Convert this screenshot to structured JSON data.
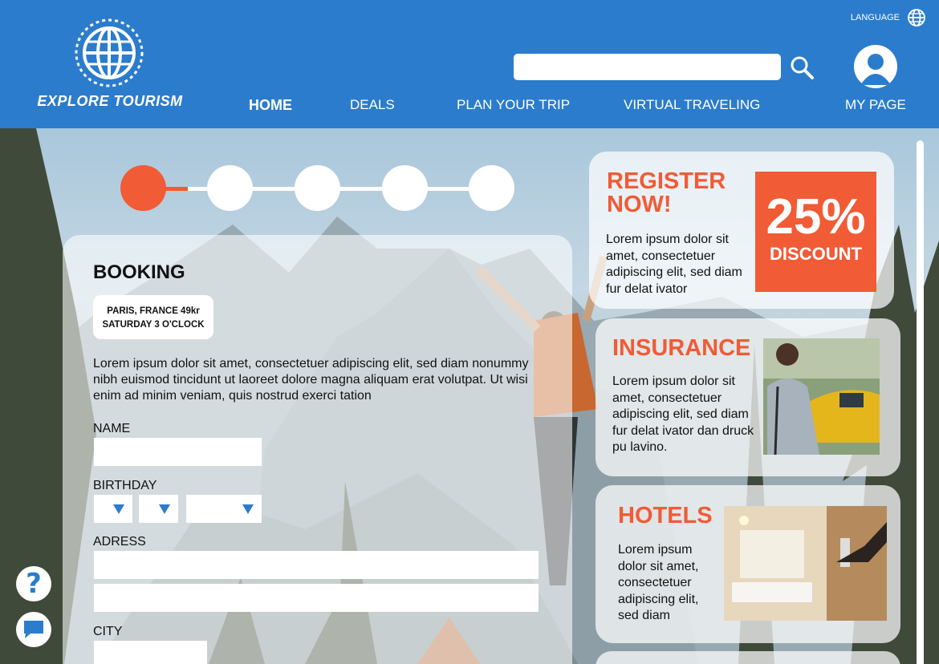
{
  "header": {
    "brand": "EXPLORE TOURISM",
    "language_label": "LANGUAGE",
    "search_placeholder": "",
    "nav": [
      {
        "label": "HOME",
        "active": true
      },
      {
        "label": "DEALS",
        "active": false
      },
      {
        "label": "PLAN YOUR TRIP",
        "active": false
      },
      {
        "label": "VIRTUAL TRAVELING",
        "active": false
      },
      {
        "label": "MY PAGE",
        "active": false
      }
    ]
  },
  "stepper": {
    "total_steps": 5,
    "completed_steps": 1
  },
  "booking": {
    "title": "BOOKING",
    "destination_line1": "PARIS, FRANCE 49kr",
    "destination_line2": "SATURDAY 3 O'CLOCK",
    "description": "Lorem ipsum dolor sit amet, consectetuer adipiscing elit, sed diam nonummy nibh euismod tincidunt ut laoreet dolore magna aliquam erat volutpat. Ut wisi enim ad minim veniam, quis nostrud exerci tation",
    "name_label": "NAME",
    "birthday_label": "BIRTHDAY",
    "address_label": "ADRESS",
    "city_label": "CITY"
  },
  "promos": {
    "register": {
      "title_line1": "REGISTER",
      "title_line2": "NOW!",
      "text": "Lorem ipsum dolor sit amet, consectetuer adipiscing elit, sed diam fur delat ivator",
      "discount_value": "25%",
      "discount_label": "DISCOUNT"
    },
    "insurance": {
      "title": "INSURANCE",
      "text": "Lorem ipsum dolor sit amet, consectetuer adipiscing elit, sed diam fur delat ivator dan druck pu lavino."
    },
    "hotels": {
      "title": "HOTELS",
      "text": "Lorem ipsum dolor sit amet, consectetuer adipiscing elit, sed diam"
    }
  },
  "colors": {
    "brand_blue": "#2b7ccc",
    "accent_orange": "#f15b36"
  },
  "icons": {
    "logo": "globe-icon",
    "language": "globe-icon",
    "search": "search-icon",
    "profile": "user-icon",
    "help": "question-icon",
    "chat": "chat-icon"
  }
}
